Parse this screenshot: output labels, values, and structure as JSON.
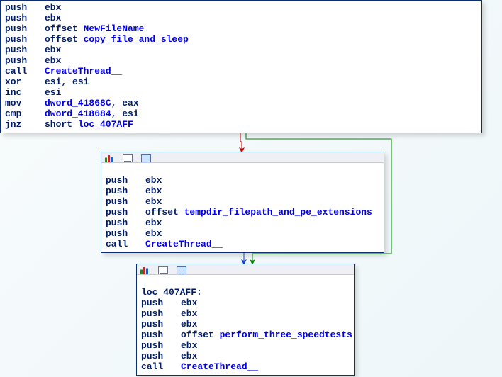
{
  "node0": {
    "lines": [
      {
        "mn": "push",
        "ops": [
          {
            "t": "reg",
            "v": "ebx"
          }
        ]
      },
      {
        "mn": "push",
        "ops": [
          {
            "t": "reg",
            "v": "ebx"
          }
        ]
      },
      {
        "mn": "push",
        "ops": [
          {
            "t": "kw",
            "v": "offset "
          },
          {
            "t": "sym",
            "v": "NewFileName"
          }
        ]
      },
      {
        "mn": "push",
        "ops": [
          {
            "t": "kw",
            "v": "offset "
          },
          {
            "t": "sym",
            "v": "copy_file_and_sleep"
          }
        ]
      },
      {
        "mn": "push",
        "ops": [
          {
            "t": "reg",
            "v": "ebx"
          }
        ]
      },
      {
        "mn": "push",
        "ops": [
          {
            "t": "reg",
            "v": "ebx"
          }
        ]
      },
      {
        "mn": "call",
        "ops": [
          {
            "t": "call",
            "v": "CreateThread__"
          }
        ]
      },
      {
        "mn": "xor",
        "ops": [
          {
            "t": "reg",
            "v": "esi"
          },
          {
            "t": "comma",
            "v": ", "
          },
          {
            "t": "reg",
            "v": "esi"
          }
        ]
      },
      {
        "mn": "inc",
        "ops": [
          {
            "t": "reg",
            "v": "esi"
          }
        ]
      },
      {
        "mn": "mov",
        "ops": [
          {
            "t": "sym",
            "v": "dword_41868C"
          },
          {
            "t": "comma",
            "v": ", "
          },
          {
            "t": "reg",
            "v": "eax"
          }
        ]
      },
      {
        "mn": "cmp",
        "ops": [
          {
            "t": "sym",
            "v": "dword_418684"
          },
          {
            "t": "comma",
            "v": ", "
          },
          {
            "t": "reg",
            "v": "esi"
          }
        ]
      },
      {
        "mn": "jnz",
        "ops": [
          {
            "t": "kw",
            "v": "short "
          },
          {
            "t": "sym",
            "v": "loc_407AFF"
          }
        ]
      }
    ]
  },
  "node1": {
    "lines": [
      {
        "mn": "push",
        "ops": [
          {
            "t": "reg",
            "v": "ebx"
          }
        ]
      },
      {
        "mn": "push",
        "ops": [
          {
            "t": "reg",
            "v": "ebx"
          }
        ]
      },
      {
        "mn": "push",
        "ops": [
          {
            "t": "reg",
            "v": "ebx"
          }
        ]
      },
      {
        "mn": "push",
        "ops": [
          {
            "t": "kw",
            "v": "offset "
          },
          {
            "t": "sym",
            "v": "tempdir_filepath_and_pe_extensions"
          }
        ]
      },
      {
        "mn": "push",
        "ops": [
          {
            "t": "reg",
            "v": "ebx"
          }
        ]
      },
      {
        "mn": "push",
        "ops": [
          {
            "t": "reg",
            "v": "ebx"
          }
        ]
      },
      {
        "mn": "call",
        "ops": [
          {
            "t": "call",
            "v": "CreateThread__"
          }
        ]
      }
    ]
  },
  "node2": {
    "label": "loc_407AFF:",
    "lines": [
      {
        "mn": "push",
        "ops": [
          {
            "t": "reg",
            "v": "ebx"
          }
        ]
      },
      {
        "mn": "push",
        "ops": [
          {
            "t": "reg",
            "v": "ebx"
          }
        ]
      },
      {
        "mn": "push",
        "ops": [
          {
            "t": "reg",
            "v": "ebx"
          }
        ]
      },
      {
        "mn": "push",
        "ops": [
          {
            "t": "kw",
            "v": "offset "
          },
          {
            "t": "sym",
            "v": "perform_three_speedtests"
          }
        ]
      },
      {
        "mn": "push",
        "ops": [
          {
            "t": "reg",
            "v": "ebx"
          }
        ]
      },
      {
        "mn": "push",
        "ops": [
          {
            "t": "reg",
            "v": "ebx"
          }
        ]
      },
      {
        "mn": "call",
        "ops": [
          {
            "t": "call",
            "v": "CreateThread__"
          }
        ]
      }
    ]
  },
  "edges": {
    "colors": {
      "fallthrough": "#cc0000",
      "jump_taken": "#008800",
      "unconditional": "#1040dd"
    }
  }
}
